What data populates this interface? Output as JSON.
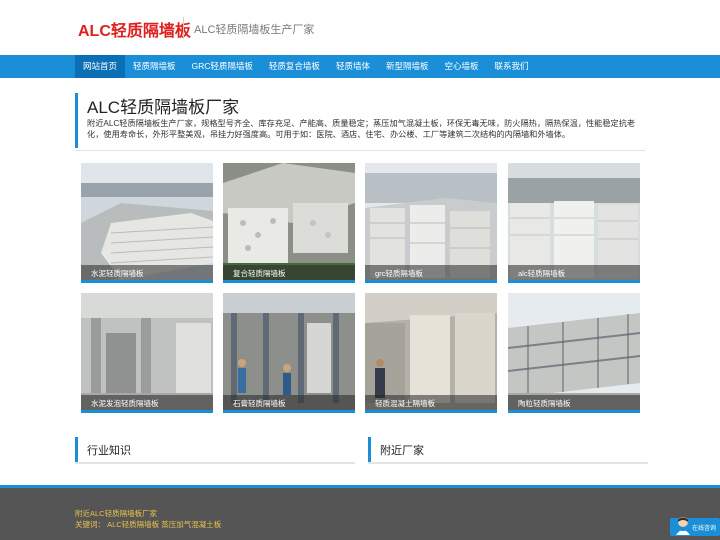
{
  "header": {
    "logo": "ALC轻质隔墙板",
    "tagline": "ALC轻质隔墙板生产厂家"
  },
  "nav": [
    {
      "label": "网站首页",
      "active": true
    },
    {
      "label": "轻质隔墙板"
    },
    {
      "label": "GRC轻质隔墙板"
    },
    {
      "label": "轻质复合墙板"
    },
    {
      "label": "轻质墙体"
    },
    {
      "label": "新型隔墙板"
    },
    {
      "label": "空心墙板"
    },
    {
      "label": "联系我们"
    }
  ],
  "intro": {
    "title": "ALC轻质隔墙板厂家",
    "description": "附近ALC轻质隔墙板生产厂家，规格型号齐全、库存充足、产能高、质量稳定；蒸压加气混凝土板，环保无毒无味，防火隔热，隔热保温，性能稳定抗老化，使用寿命长，外形平整美观，吊挂力好强度高。可用于如：医院、酒店、住宅、办公楼、工厂等建筑二次结构的内隔墙和外墙体。"
  },
  "products": [
    {
      "caption": "水泥轻质隔墙板"
    },
    {
      "caption": "复合轻质隔墙板"
    },
    {
      "caption": "grc轻质隔墙板"
    },
    {
      "caption": "alc轻质隔墙板"
    },
    {
      "caption": "水泥发泡轻质隔墙板"
    },
    {
      "caption": "石膏轻质隔墙板"
    },
    {
      "caption": "轻质混凝土隔墙板"
    },
    {
      "caption": "陶粒轻质隔墙板"
    }
  ],
  "sections": {
    "industry": "行业知识",
    "nearby": "附近厂家"
  },
  "footer": {
    "line1": "附近ALC轻质隔墙板厂家",
    "keywords_label": "关键词：",
    "keyword1": "ALC轻质隔墙板",
    "keyword2": "蒸压加气混凝土板"
  },
  "chat": {
    "label": "在线咨询"
  },
  "colors": {
    "accent": "#1a8fd8",
    "logo_red": "#e02020",
    "footer_bg": "#555555",
    "footer_text": "#e8c34a"
  }
}
